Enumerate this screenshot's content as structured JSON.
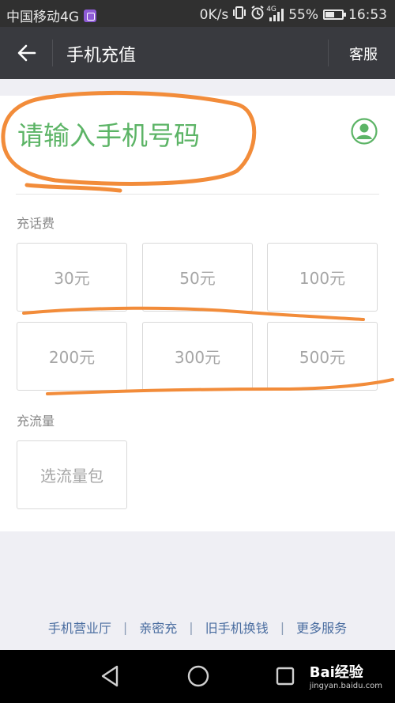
{
  "status_bar": {
    "carrier": "中国移动4G",
    "speed": "0K/s",
    "network": "4G",
    "battery": "55%",
    "battery_level": 0.55,
    "time": "16:53"
  },
  "nav": {
    "title": "手机充值",
    "service_label": "客服"
  },
  "phone": {
    "placeholder": "请输入手机号码"
  },
  "topup": {
    "label": "充话费",
    "options": [
      "30元",
      "50元",
      "100元",
      "200元",
      "300元",
      "500元"
    ]
  },
  "data_plan": {
    "label": "充流量",
    "option": "选流量包"
  },
  "footer": {
    "links": [
      "手机营业厅",
      "亲密充",
      "旧手机换钱",
      "更多服务"
    ],
    "separator": "|"
  },
  "watermark": {
    "brand": "Bai经验",
    "url": "jingyan.baidu.com"
  },
  "colors": {
    "accent_green": "#5cb466",
    "annotation_orange": "#f28c3a",
    "nav_bg": "#393a3f",
    "link_blue": "#4a6da0"
  }
}
